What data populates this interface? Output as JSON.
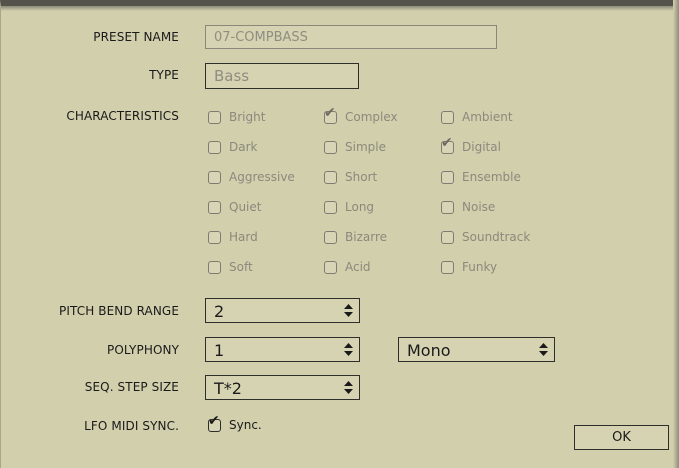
{
  "labels": {
    "preset_name": "PRESET NAME",
    "type": "TYPE",
    "characteristics": "CHARACTERISTICS",
    "pitch_bend_range": "PITCH BEND RANGE",
    "polyphony": "POLYPHONY",
    "seq_step_size": "SEQ. STEP SIZE",
    "lfo_midi_sync": "LFO MIDI SYNC."
  },
  "preset_name": {
    "value": "07-COMPBASS"
  },
  "type": {
    "value": "Bass"
  },
  "characteristics": {
    "columns": [
      [
        {
          "label": "Bright",
          "checked": false
        },
        {
          "label": "Dark",
          "checked": false
        },
        {
          "label": "Aggressive",
          "checked": false
        },
        {
          "label": "Quiet",
          "checked": false
        },
        {
          "label": "Hard",
          "checked": false
        },
        {
          "label": "Soft",
          "checked": false
        }
      ],
      [
        {
          "label": "Complex",
          "checked": true
        },
        {
          "label": "Simple",
          "checked": false
        },
        {
          "label": "Short",
          "checked": false
        },
        {
          "label": "Long",
          "checked": false
        },
        {
          "label": "Bizarre",
          "checked": false
        },
        {
          "label": "Acid",
          "checked": false
        }
      ],
      [
        {
          "label": "Ambient",
          "checked": false
        },
        {
          "label": "Digital",
          "checked": true
        },
        {
          "label": "Ensemble",
          "checked": false
        },
        {
          "label": "Noise",
          "checked": false
        },
        {
          "label": "Soundtrack",
          "checked": false
        },
        {
          "label": "Funky",
          "checked": false
        }
      ]
    ]
  },
  "pitch_bend_range": {
    "value": "2"
  },
  "polyphony": {
    "value": "1",
    "mode": "Mono"
  },
  "seq_step_size": {
    "value": "T*2"
  },
  "lfo_midi_sync": {
    "label": "Sync.",
    "checked": true
  },
  "ok_label": "OK",
  "colors": {
    "panel": "#d2cfad",
    "field": "#d6d3b2",
    "disabled_text": "#8b897c",
    "border_dark": "#2e2e2a"
  },
  "icons": {
    "checkmark": "checkmark-icon",
    "updown": "up-down-arrows-icon"
  }
}
